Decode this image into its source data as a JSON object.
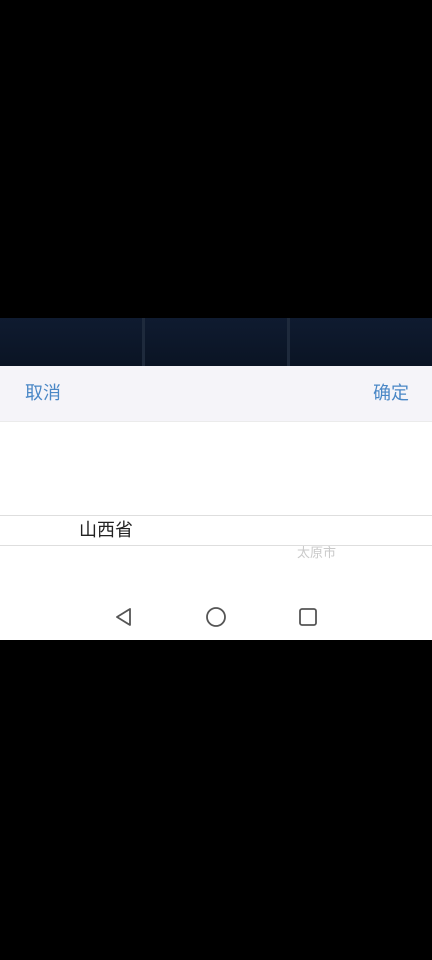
{
  "toolbar": {
    "cancel_label": "取消",
    "confirm_label": "确定"
  },
  "picker": {
    "selected_province": "山西省",
    "next_city": "太原市"
  },
  "navbar": {
    "back_icon": "back-triangle-icon",
    "home_icon": "home-circle-icon",
    "recent_icon": "recent-apps-square-icon"
  },
  "colors": {
    "accent": "#4a87c6",
    "toolbar_bg": "#f5f4f9",
    "background": "#000000"
  }
}
